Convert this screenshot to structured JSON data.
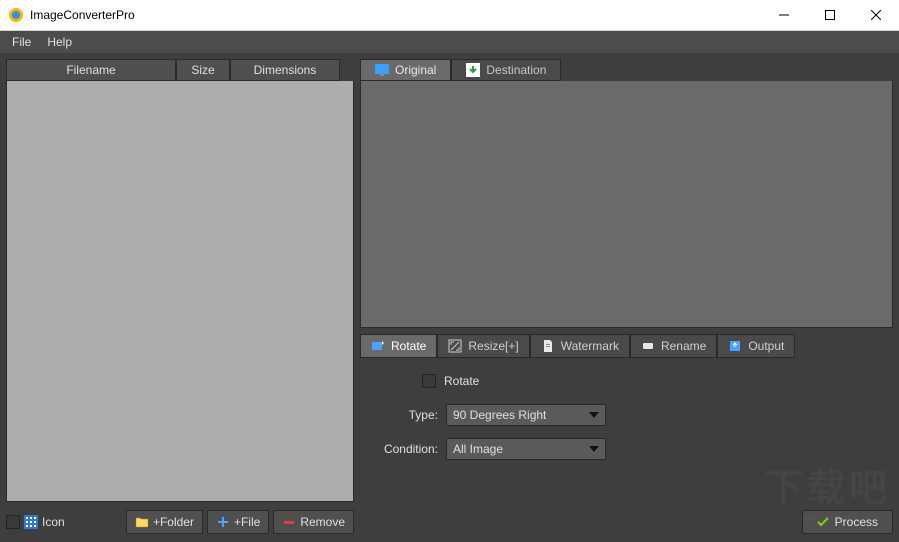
{
  "window": {
    "title": "ImageConverterPro"
  },
  "menu": {
    "file": "File",
    "help": "Help"
  },
  "table": {
    "cols": {
      "filename": "Filename",
      "size": "Size",
      "dimensions": "Dimensions"
    }
  },
  "left_toolbar": {
    "icon_label": "Icon",
    "add_folder": "+Folder",
    "add_file": "+File",
    "remove": "Remove"
  },
  "preview_tabs": {
    "original": "Original",
    "destination": "Destination"
  },
  "op_tabs": {
    "rotate": "Rotate",
    "resize": "Resize[+]",
    "watermark": "Watermark",
    "rename": "Rename",
    "output": "Output"
  },
  "rotate_panel": {
    "checkbox_label": "Rotate",
    "type_label": "Type:",
    "type_value": "90 Degrees Right",
    "condition_label": "Condition:",
    "condition_value": "All Image"
  },
  "process_label": "Process"
}
